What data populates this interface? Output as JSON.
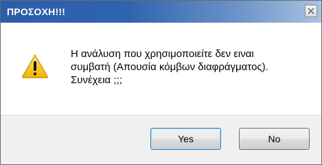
{
  "window": {
    "title": "ΠΡΟΣΟΧΗ!!!",
    "close_symbol": "×"
  },
  "message": {
    "lines": [
      "Η ανάλυση που χρησιμοποιείτε δεν ειναι",
      "συμβατή (Απουσία κόμβων διαφράγματος).",
      "Συνέχεια ;;;"
    ]
  },
  "icons": {
    "warning": "warning-icon",
    "close": "close-icon"
  },
  "buttons": {
    "yes_label": "Yes",
    "no_label": "No",
    "default": "yes"
  },
  "colors": {
    "titlebar_start": "#2a5ea8",
    "titlebar_end": "#a9c3e3",
    "warning_fill": "#f7c200",
    "default_button_border": "#3c7fb1"
  }
}
